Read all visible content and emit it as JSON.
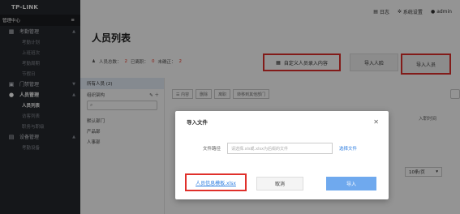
{
  "brand": "TP-LINK",
  "sidebar": {
    "management_center": "管理中心",
    "menu_icon": "hamburger-icon",
    "groups": [
      {
        "label": "考勤管理",
        "icon": "calendar-icon",
        "items": [
          "考勤计划",
          "上班班次",
          "考勤周期",
          "节假日"
        ]
      },
      {
        "label": "门禁管理",
        "icon": "door-icon",
        "items": []
      },
      {
        "label": "人员管理",
        "icon": "person-icon",
        "items": [
          "人员列表",
          "访客列表",
          "职务与职级"
        ]
      },
      {
        "label": "设备管理",
        "icon": "device-icon",
        "items": [
          "考勤设备"
        ]
      }
    ],
    "active_item": "人员列表"
  },
  "topbar": {
    "log": "日志",
    "settings": "系统设置",
    "user": "admin"
  },
  "page": {
    "title": "人员列表",
    "stats": {
      "total_label": "人员总数：",
      "total": "2",
      "left_label": "已离职：",
      "left": "0",
      "unassigned_label": "未确正：",
      "unassigned": "2"
    },
    "buttons": {
      "custom_fields": "自定义人员录入内容",
      "import_face": "导入人脸",
      "import_person": "导入人员"
    }
  },
  "departments": {
    "all": "所有人员 (2)",
    "org_label": "组织架构",
    "items": [
      "默认部门",
      "产品部",
      "人事部"
    ]
  },
  "table": {
    "toolbar": [
      "☰ 内容",
      "删除",
      "离职",
      "转移到其他部门"
    ],
    "column_join_time": "入职时间",
    "per_page": "10条/页"
  },
  "modal": {
    "title": "导入文件",
    "field_label": "文件路径",
    "placeholder": "请选择.xls或.xlsx为后缀的文件",
    "choose_file": "选择文件",
    "template_link": "人员信息模板.xlsx",
    "cancel": "取消",
    "import": "导入"
  },
  "colors": {
    "sidebar_bg": "#25282d",
    "highlight_border": "#e0302b",
    "link": "#2d7de0",
    "primary_button": "#6fa9ee"
  }
}
